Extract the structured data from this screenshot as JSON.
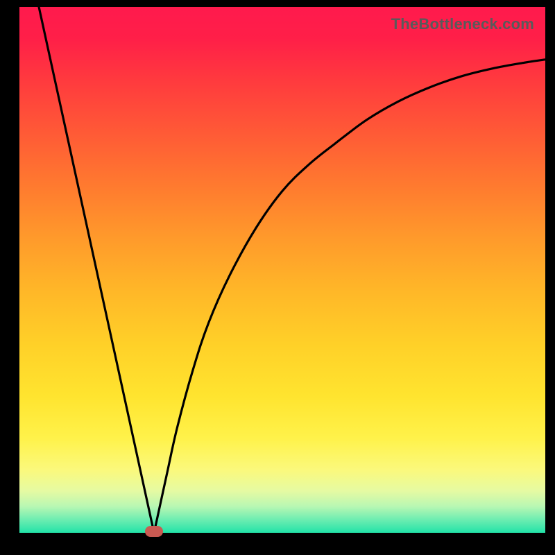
{
  "attribution": "TheBottleneck.com",
  "colors": {
    "frame": "#000000",
    "curve": "#000000",
    "marker": "#c95a52",
    "gradient_top": "#ff1a4d",
    "gradient_bottom": "#22e3a8"
  },
  "chart_data": {
    "type": "line",
    "title": "",
    "xlabel": "",
    "ylabel": "",
    "xlim": [
      0,
      100
    ],
    "ylim": [
      0,
      100
    ],
    "grid": false,
    "legend": false,
    "series": [
      {
        "name": "left-segment",
        "x": [
          3.7,
          25.6
        ],
        "y": [
          100,
          0
        ]
      },
      {
        "name": "right-segment",
        "x": [
          25.6,
          28,
          30,
          33,
          36,
          40,
          45,
          50,
          55,
          60,
          66,
          72,
          78,
          84,
          90,
          96,
          100
        ],
        "y": [
          0,
          11,
          20,
          31,
          40,
          49,
          58,
          65,
          70,
          74,
          78.5,
          82,
          84.7,
          86.8,
          88.3,
          89.4,
          90
        ]
      }
    ],
    "annotations": [
      {
        "name": "minimum-marker",
        "x": 25.6,
        "y": 0
      }
    ]
  }
}
